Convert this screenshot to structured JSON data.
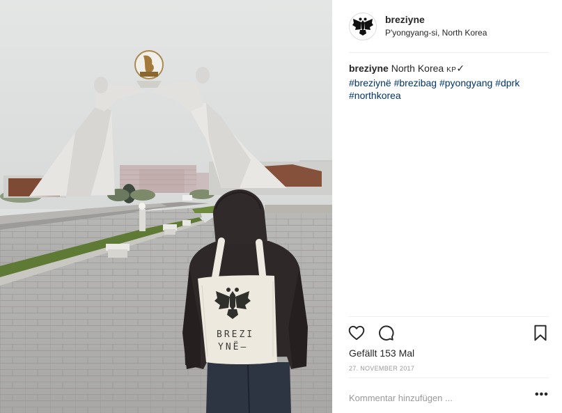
{
  "post": {
    "username": "breziyne",
    "location": "P'yongyang-si, North Korea",
    "caption": {
      "username": "breziyne",
      "text": "North Korea",
      "flag": "KP",
      "check": "✓",
      "hashtags": [
        "#breziynë",
        "#brezibag",
        "#pyongyang",
        "#dprk",
        "#northkorea"
      ]
    },
    "likes_text": "Gefällt 153 Mal",
    "date": "27. NOVEMBER 2017",
    "comment_placeholder": "Kommentar hinzufügen ...",
    "more_label": "•••",
    "bag_text_line1": "BREZI",
    "bag_text_line2": "YNË—"
  },
  "colors": {
    "text": "#262626",
    "muted": "#999999",
    "hashtag": "#003569",
    "divider": "#efefef"
  },
  "icons": [
    "eagle-logo-icon",
    "heart-icon",
    "comment-icon",
    "bookmark-icon",
    "more-icon"
  ]
}
